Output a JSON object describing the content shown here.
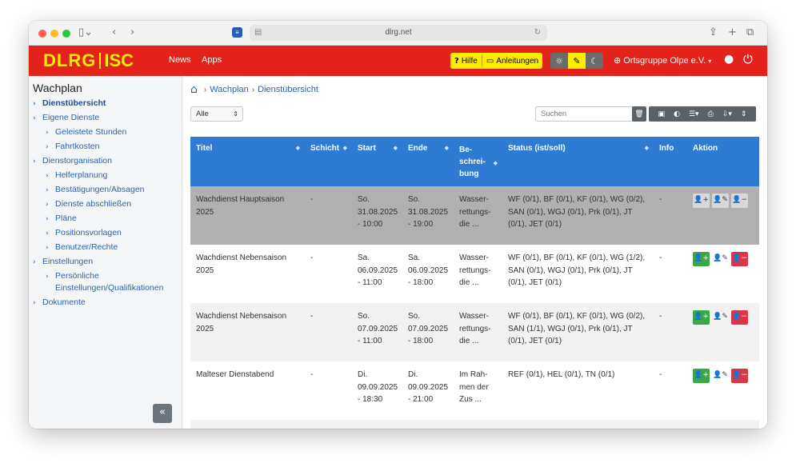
{
  "browser": {
    "url": "dlrg.net"
  },
  "header": {
    "logo_left": "DLRG",
    "logo_right": "ISC",
    "nav": [
      "News",
      "Apps"
    ],
    "help_label": "Hilfe",
    "guides_label": "Anleitungen",
    "org_label": "Ortsgruppe Olpe e.V.",
    "brand_color": "#e3231b",
    "accent_color": "#ffed00"
  },
  "sidebar": {
    "title": "Wachplan",
    "items": [
      {
        "label": "Dienstübersicht",
        "level": 0,
        "active": true
      },
      {
        "label": "Eigene Dienste",
        "level": 0
      },
      {
        "label": "Geleistete Stunden",
        "level": 1
      },
      {
        "label": "Fahrtkosten",
        "level": 1
      },
      {
        "label": "Dienstorganisation",
        "level": 0
      },
      {
        "label": "Helferplanung",
        "level": 1
      },
      {
        "label": "Bestätigungen/Absagen",
        "level": 1
      },
      {
        "label": "Dienste abschließen",
        "level": 1
      },
      {
        "label": "Pläne",
        "level": 1
      },
      {
        "label": "Positionsvorlagen",
        "level": 1
      },
      {
        "label": "Benutzer/Rechte",
        "level": 1
      },
      {
        "label": "Einstellungen",
        "level": 0
      },
      {
        "label": "Persönliche",
        "level": 1
      },
      {
        "label": "Einstellungen/Qualifikationen",
        "level": 1
      },
      {
        "label": "Dokumente",
        "level": 0
      }
    ],
    "collapse_label": "«"
  },
  "main": {
    "breadcrumb": [
      "Wachplan",
      "Dienstübersicht"
    ],
    "filter_value": "Alle",
    "search_placeholder": "Suchen",
    "columns": [
      "Titel",
      "Schicht",
      "Start",
      "Ende",
      "Be-\nschrei-\nbung",
      "Status (ist/soll)",
      "Info",
      "Aktion"
    ],
    "rows": [
      {
        "titel": "Wachdienst Hauptsaison 2025",
        "schicht": "-",
        "start": "So.\n31.08.2025\n- 10:00",
        "ende": "So.\n31.08.2025\n- 19:00",
        "beschreibung": "Wasser-\nrettungs-\ndie ...",
        "status": "WF (0/1), BF (0/1), KF (0/1), WG (0/2), SAN (0/1), WGJ (0/1), Prk (0/1), JT (0/1), JET (0/1)",
        "info": "-"
      },
      {
        "titel": "Wachdienst Nebensaison 2025",
        "schicht": "-",
        "start": "Sa.\n06.09.2025\n- 11:00",
        "ende": "Sa.\n06.09.2025\n- 18:00",
        "beschreibung": "Wasser-\nrettungs-\ndie ...",
        "status": "WF (0/1), BF (0/1), KF (0/1), WG (1/2), SAN (0/1), WGJ (0/1), Prk (0/1), JT (0/1), JET (0/1)",
        "info": "-"
      },
      {
        "titel": "Wachdienst Nebensaison 2025",
        "schicht": "-",
        "start": "So.\n07.09.2025\n- 11:00",
        "ende": "So.\n07.09.2025\n- 18:00",
        "beschreibung": "Wasser-\nrettungs-\ndie ...",
        "status": "WF (0/1), BF (0/1), KF (0/1), WG (0/2), SAN (1/1), WGJ (0/1), Prk (0/1), JT (0/1), JET (0/1)",
        "info": "-"
      },
      {
        "titel": "Malteser Dienstabend",
        "schicht": "-",
        "start": "Di.\n09.09.2025\n- 18:30",
        "ende": "Di.\n09.09.2025\n- 21:00",
        "beschreibung": "Im Rah-\nmen der\nZus ...",
        "status": "REF (0/1), HEL (0/1), TN (0/1)",
        "info": "-"
      }
    ],
    "header_color": "#2f7bd4"
  }
}
